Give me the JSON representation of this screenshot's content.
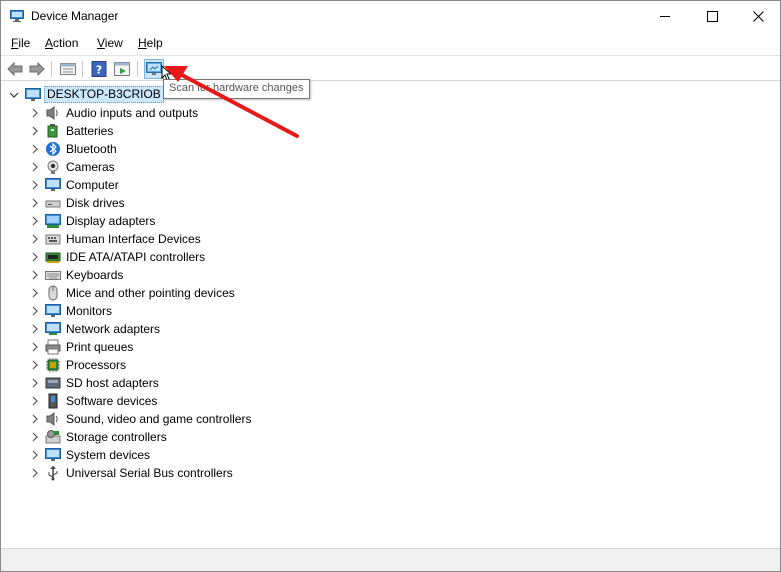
{
  "window": {
    "title": "Device Manager"
  },
  "menu": {
    "items": [
      {
        "label": "File",
        "accel": "F",
        "rest": "ile"
      },
      {
        "label": "Action",
        "accel": "A",
        "rest": "ction"
      },
      {
        "label": "View",
        "accel": "V",
        "rest": "iew"
      },
      {
        "label": "Help",
        "accel": "H",
        "rest": "elp"
      }
    ]
  },
  "toolbar": {
    "buttons": [
      "back-icon",
      "forward-icon",
      "properties-icon",
      "help-icon",
      "update-driver-icon",
      "scan-hardware-icon"
    ],
    "active": "scan-hardware-icon"
  },
  "tooltip": {
    "text": "Scan for hardware changes"
  },
  "tree": {
    "root": "DESKTOP-B3CRIOB",
    "items": [
      {
        "label": "Audio inputs and outputs",
        "icon": "speaker-icon"
      },
      {
        "label": "Batteries",
        "icon": "battery-icon"
      },
      {
        "label": "Bluetooth",
        "icon": "bluetooth-icon"
      },
      {
        "label": "Cameras",
        "icon": "camera-icon"
      },
      {
        "label": "Computer",
        "icon": "computer-icon"
      },
      {
        "label": "Disk drives",
        "icon": "disk-drive-icon"
      },
      {
        "label": "Display adapters",
        "icon": "display-adapter-icon"
      },
      {
        "label": "Human Interface Devices",
        "icon": "hid-icon"
      },
      {
        "label": "IDE ATA/ATAPI controllers",
        "icon": "ide-controller-icon"
      },
      {
        "label": "Keyboards",
        "icon": "keyboard-icon"
      },
      {
        "label": "Mice and other pointing devices",
        "icon": "mouse-icon"
      },
      {
        "label": "Monitors",
        "icon": "monitor-icon"
      },
      {
        "label": "Network adapters",
        "icon": "network-adapter-icon"
      },
      {
        "label": "Print queues",
        "icon": "printer-icon"
      },
      {
        "label": "Processors",
        "icon": "processor-icon"
      },
      {
        "label": "SD host adapters",
        "icon": "sd-card-icon"
      },
      {
        "label": "Software devices",
        "icon": "software-device-icon"
      },
      {
        "label": "Sound, video and game controllers",
        "icon": "sound-icon"
      },
      {
        "label": "Storage controllers",
        "icon": "storage-controller-icon"
      },
      {
        "label": "System devices",
        "icon": "system-device-icon"
      },
      {
        "label": "Universal Serial Bus controllers",
        "icon": "usb-icon"
      }
    ]
  },
  "colors": {
    "selection": "#cce8ff",
    "annotation_arrow": "#e81818",
    "toolbar_active": "#cde4f7"
  }
}
